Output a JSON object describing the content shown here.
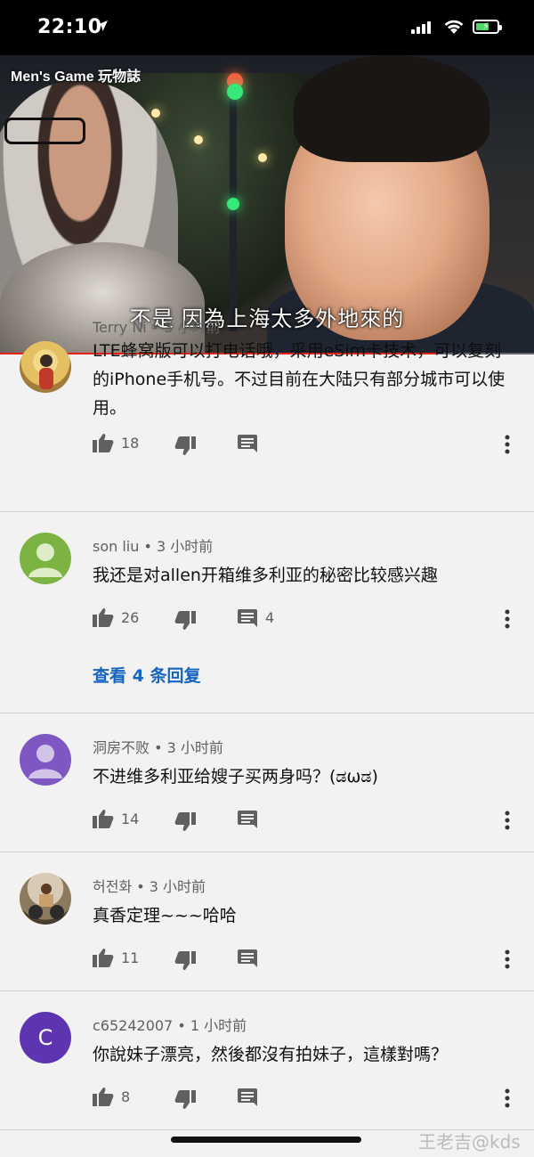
{
  "status_bar": {
    "time": "22:10",
    "battery_color": "#4cd964"
  },
  "video": {
    "brand": "Men's Game 玩物誌",
    "subtitle": "不是 因為上海太多外地來的",
    "progress_fraction": 0.82,
    "progress_color": "#e62117"
  },
  "comments": [
    {
      "author": "Terry Ni • 3 小时前",
      "text": "LTE蜂窝版可以打电话哦，采用eSim卡技术，可以复刻的iPhone手机号。不过目前在大陆只有部分城市可以使用。",
      "likes": "18",
      "replies": "",
      "avatar": "photo"
    },
    {
      "author": "son liu • 3 小时前",
      "text": "我还是对allen开箱维多利亚的秘密比较感兴趣",
      "likes": "26",
      "replies": "4",
      "view_replies": "查看 4 条回复",
      "avatar": "default-green"
    },
    {
      "author": "洞房不败 • 3 小时前",
      "text": "不进维多利亚给嫂子买两身吗？(ಡωಡ)",
      "likes": "14",
      "replies": "",
      "avatar": "default-purple"
    },
    {
      "author": "허전화 • 3 小时前",
      "text": "真香定理~~~哈哈",
      "likes": "11",
      "replies": "",
      "avatar": "photo-moto"
    },
    {
      "author": "c65242007 • 1 小时前",
      "text": "你說妹子漂亮，然後都沒有拍妹子，這樣對嗎？",
      "likes": "8",
      "replies": "",
      "avatar": "letter",
      "avatar_letter": "C",
      "avatar_color": "#5e35b1"
    }
  ],
  "watermark": "王老吉@kds",
  "icons": {
    "like": "thumbs-up-icon",
    "dislike": "thumbs-down-icon",
    "reply": "comment-icon",
    "more": "more-vert-icon"
  }
}
